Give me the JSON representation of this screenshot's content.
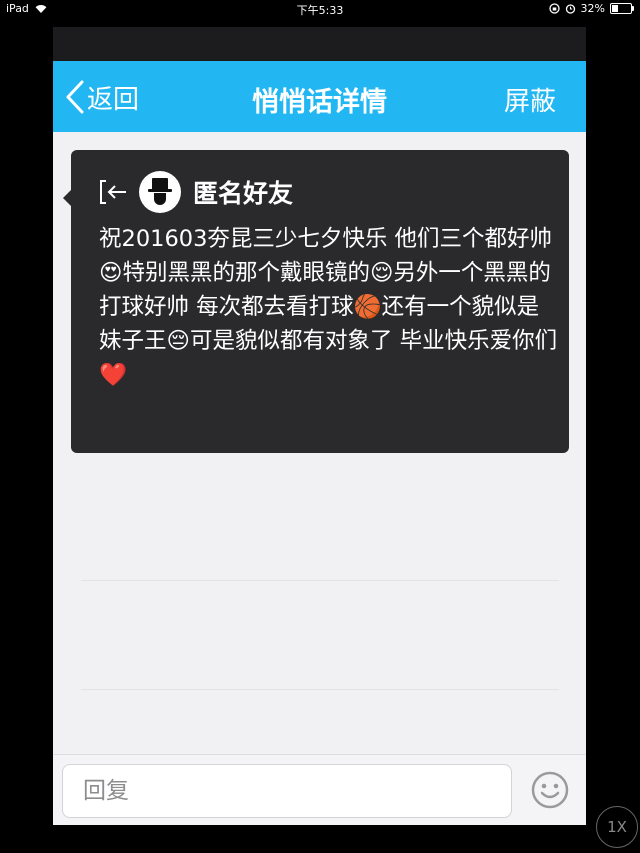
{
  "status_bar": {
    "device": "iPad",
    "time": "下午5:33",
    "battery_percent": "32%",
    "battery_level": 0.32
  },
  "nav": {
    "back_label": "返回",
    "title": "悄悄话详情",
    "action_label": "屏蔽"
  },
  "message": {
    "sender": "匿名好友",
    "text": "祝201603夯昆三少七夕快乐 他们三个都好帅😍特别黑黑的那个戴眼镜的😌另外一个黑黑的打球好帅 每次都去看打球🏀还有一个貌似是妹子王😔可是貌似都有对象了 毕业快乐爱你们❤️"
  },
  "reply": {
    "placeholder": "回复"
  },
  "zoom_button": {
    "label": "1X"
  },
  "colors": {
    "nav_bg": "#22b7f3",
    "bubble_bg": "#2a2a2c",
    "page_bg": "#f1f1f3"
  }
}
